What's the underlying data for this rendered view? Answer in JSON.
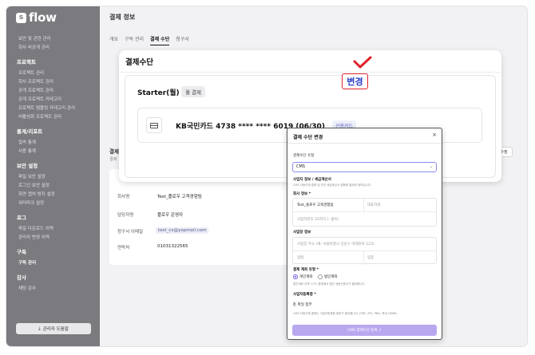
{
  "brand": {
    "logo_text": "flow",
    "logo_mark": "s"
  },
  "sidebar": {
    "groups": [
      {
        "title": "",
        "items": [
          "보안 및 관한 관리",
          "회사 비공개 관리"
        ]
      },
      {
        "title": "프로젝트",
        "items": [
          "프로젝트 관리",
          "회사 프로젝트 관리",
          "공개 프로젝트 관리",
          "공개 프로젝트 카테고리",
          "프로젝트 템플릿 카테고리 관리",
          "비활성화 프로젝트 관리"
        ]
      },
      {
        "title": "통계/리포트",
        "items": [
          "접속 통계",
          "사용 통계"
        ]
      },
      {
        "title": "보안 설정",
        "items": [
          "파일 보안 설정",
          "로그인 보안 설정",
          "화면 캡처 방지 설정",
          "워터마크 설정"
        ]
      },
      {
        "title": "로그",
        "items": [
          "파일 다운로드 이력",
          "관리자 변경 이력"
        ]
      },
      {
        "title": "구독",
        "items": [
          "구독 관리"
        ]
      },
      {
        "title": "감사",
        "items": [
          "채팅 감사"
        ]
      }
    ],
    "active_item": "구독 관리",
    "download_button": "관리자 도움말"
  },
  "main": {
    "title": "결제 정보",
    "tabs": [
      "개요",
      "구독 관리",
      "결제 수단",
      "청구서"
    ],
    "active_tab": "결제 수단",
    "bg_section": "결제",
    "bg_subtitle": "결제",
    "bg_edit": "수정",
    "info_rows": [
      {
        "label": "회사명",
        "value": "Test_플로우 고객경험팀"
      },
      {
        "label": "담당자명",
        "value": "플로우 운영자"
      },
      {
        "label": "청구서 이메일",
        "value": "test_cx@yopmail.com"
      },
      {
        "label": "연락처",
        "value": "01031322565"
      }
    ]
  },
  "panel": {
    "title": "결제수단",
    "plan_name": "Starter(월)",
    "plan_badge": "월 결제",
    "card_number": "KB국민카드 4738 **** **** 6019 (06/30)",
    "card_type": "신용카드",
    "change_button": "변경"
  },
  "modal": {
    "title": "결제 수단 변경",
    "close": "×",
    "method_label": "결제수단 유형",
    "method_value": "CMS",
    "biz_section": "사업자 정보 / 세금계산서",
    "biz_help": "CMS 자동이체 결제 및 전자 세금계산서 발행에 필요한 정보입니다.",
    "company_label": "회사 정보 *",
    "company_name": "Test_플로우 고객경험팀",
    "ceo_placeholder": "대표자명",
    "bizno_placeholder": "사업자번호 10자리 (- 없이)",
    "address_label": "사업장 정보",
    "address_placeholder": "사업장 주소 (예: 서울특별시 강남구 테헤란로 123)",
    "type_placeholder": "업태",
    "item_placeholder": "업종",
    "account_label": "결제 계좌 유형 *",
    "account_personal": "개인계좌",
    "account_corporate": "법인계좌",
    "account_help": "법인계좌 선택 시 PC 환경에서 법인 공동인증서가 필요합니다.",
    "cert_label": "사업자등록증 *",
    "attach_button": "파일 첨부",
    "attach_help": "CMS 자동이체 결제는 사업자등록증 첨부가 필요합니다. (PDF, JPG, PNG, 최대 20MB)",
    "submit_button": "CMS 결제수단 등록 ↗"
  }
}
